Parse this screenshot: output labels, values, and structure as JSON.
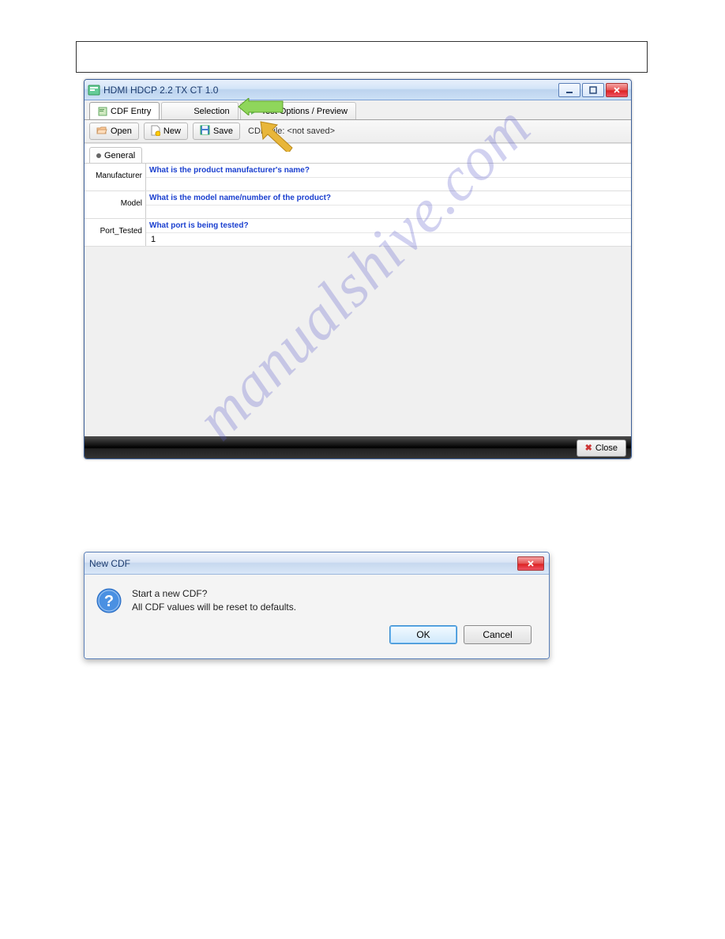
{
  "main_window": {
    "title": "HDMI HDCP 2.2 TX CT 1.0",
    "tabs": {
      "cdf_entry": "CDF Entry",
      "selection_partial": "Selection",
      "test_options": "Test Options / Preview"
    },
    "toolbar": {
      "open": "Open",
      "new": "New",
      "save": "Save",
      "cdf_file_label": "CDF File: <not saved>"
    },
    "subtab": {
      "general": "General"
    },
    "fields": {
      "manufacturer": {
        "label": "Manufacturer",
        "question": "What is the product manufacturer's name?",
        "value": ""
      },
      "model": {
        "label": "Model",
        "question": "What is the model name/number of the product?",
        "value": ""
      },
      "port": {
        "label": "Port_Tested",
        "question": "What port is being tested?",
        "value": "1"
      }
    },
    "close_button": "Close"
  },
  "dialog": {
    "title": "New CDF",
    "line1": "Start a new CDF?",
    "line2": "All CDF values will be reset to defaults.",
    "ok": "OK",
    "cancel": "Cancel"
  },
  "watermark": "manualshive.com"
}
